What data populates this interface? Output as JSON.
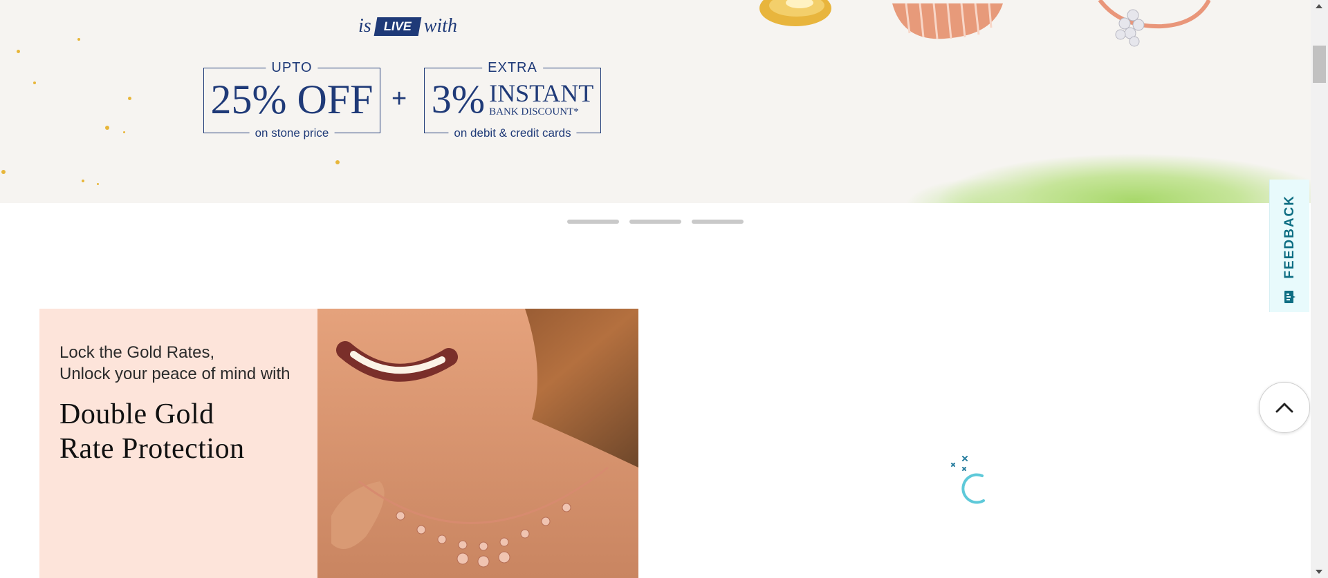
{
  "hero": {
    "live_prefix": "is",
    "live_badge": "LIVE",
    "live_suffix": "with",
    "offer1": {
      "top": "UPTO",
      "big": "25% OFF",
      "bottom": "on stone price"
    },
    "plus": "+",
    "offer2": {
      "top": "EXTRA",
      "big": "3%",
      "big2": "INSTANT",
      "big3": "BANK DISCOUNT*",
      "bottom": "on debit & credit cards"
    }
  },
  "carousel": {
    "slide_count": 3
  },
  "promo": {
    "subtitle_line1": "Lock the Gold Rates,",
    "subtitle_line2": "Unlock your peace of mind with",
    "headline_line1": "Double Gold",
    "headline_line2": "Rate Protection"
  },
  "feedback": {
    "label": "FEEDBACK"
  },
  "colors": {
    "brand_navy": "#1f3a78",
    "feedback_bg": "#e8fafc",
    "feedback_text": "#0e6e83",
    "promo_bg": "#fde4da",
    "loader": "#5ec9d9"
  },
  "icons": {
    "back_to_top": "chevron-up-icon",
    "feedback": "feedback-icon",
    "loader": "loading-spinner-icon"
  }
}
